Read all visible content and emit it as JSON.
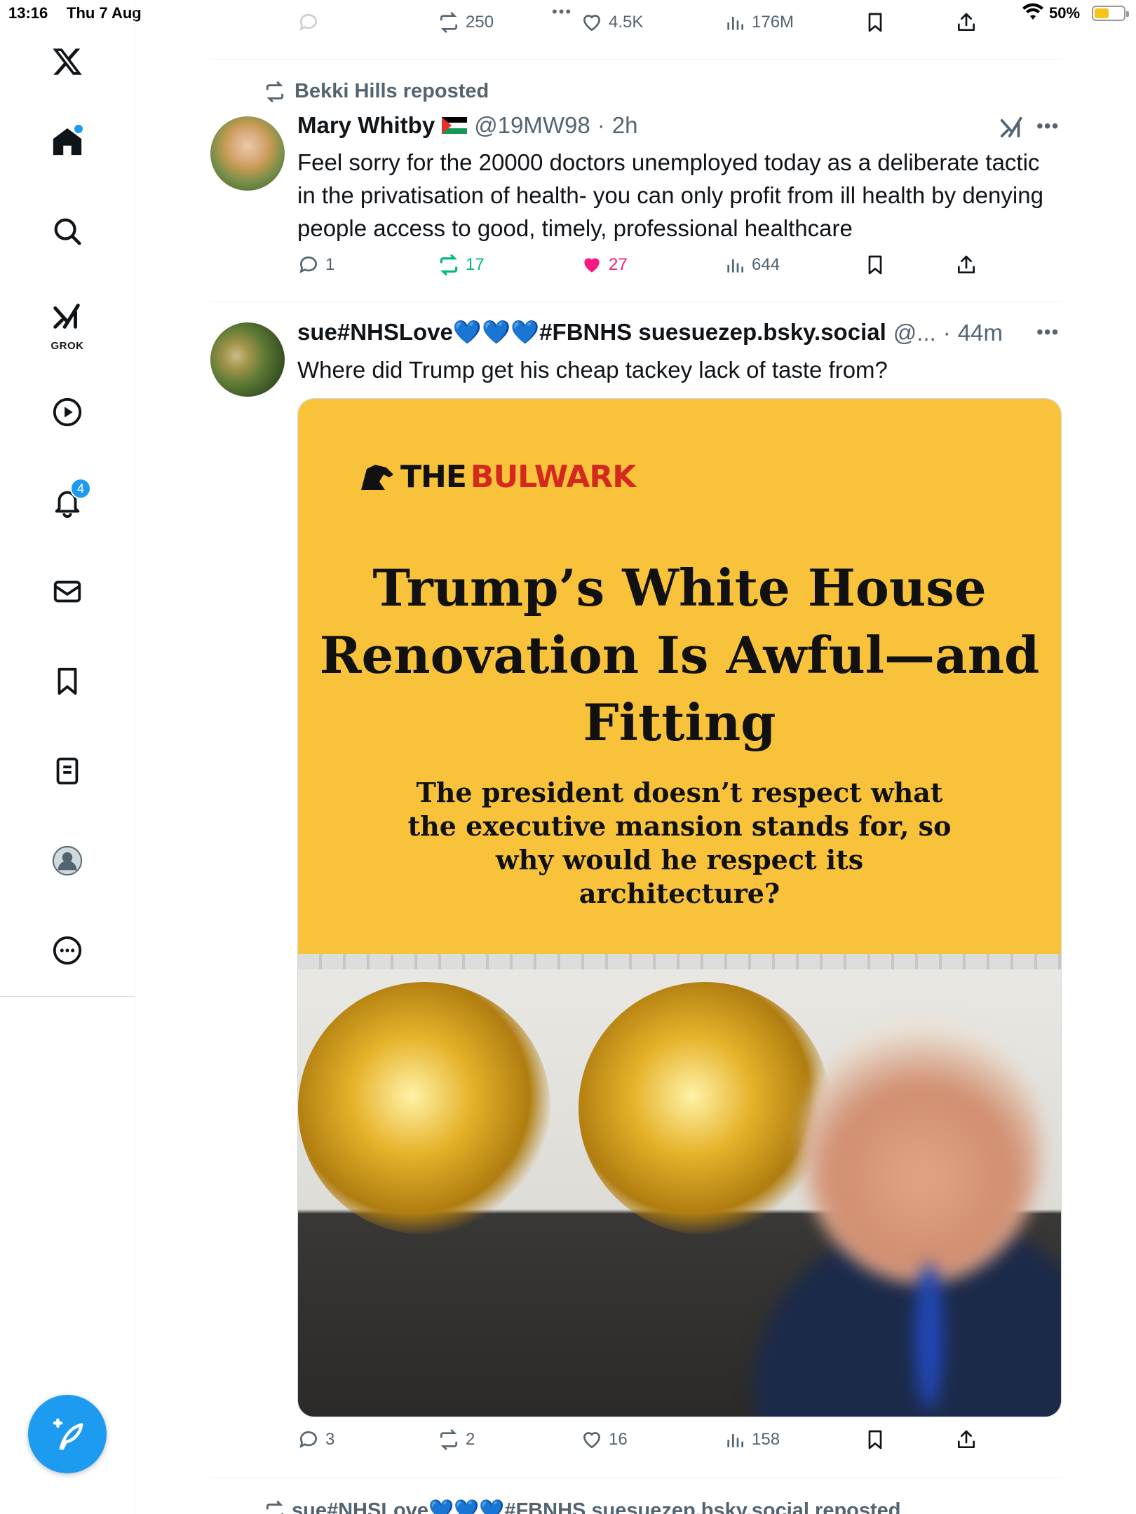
{
  "status_bar": {
    "time": "13:16",
    "date": "Thu 7 Aug",
    "battery": "50%",
    "battery_level": 0.5
  },
  "sidebar": {
    "notifications_badge": "4",
    "grok_label": "GROK"
  },
  "top_action_bar": {
    "reposts": "250",
    "likes": "4.5K",
    "views": "176M"
  },
  "tweet1": {
    "repost_label": "Bekki Hills reposted",
    "author_name": "Mary Whitby",
    "handle": "@19MW98",
    "time": "2h",
    "text": "Feel sorry for the 20000 doctors unemployed today as a deliberate tactic in the privatisation of health- you can only profit from ill health by denying people access to good, timely, professional healthcare",
    "replies": "1",
    "reposts": "17",
    "likes": "27",
    "views": "644"
  },
  "tweet2": {
    "author_name": "sue#NHSLove💙💙💙#FBNHS suesuezep.bsky.social",
    "handle": "@...",
    "time": "44m",
    "text": "Where did Trump get his cheap tackey lack of taste from?",
    "media": {
      "logo_the": "THE",
      "logo_bulwark": "BULWARK",
      "headline": "Trump’s White House Renovation Is Awful—and Fitting",
      "subhead": "The president doesn’t respect what the executive mansion stands for, so why would he respect its architecture?"
    },
    "replies": "3",
    "reposts": "2",
    "likes": "16",
    "views": "158"
  },
  "next_repost_label": "sue#NHSLove💙💙💙#FBNHS suesuezep.bsky.social reposted",
  "colors": {
    "accent": "#1d9bf0",
    "repost_green": "#00ba7c",
    "like_pink": "#f91880",
    "bulwark_yellow": "#f8c33b",
    "bulwark_red": "#d4291f"
  }
}
